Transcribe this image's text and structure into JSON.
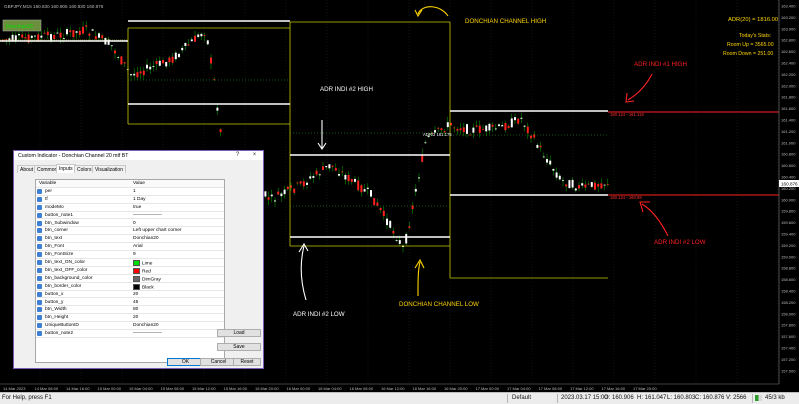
{
  "chart": {
    "symbol_header": "GBPJPY,M15 160.830 160.906 160.830 160.876",
    "indicator_badge": "Donchian20",
    "adr_label": "ADR(20) = 1816.00",
    "todays_stats": "Today's Stats:",
    "room_up": "Room Up = 3565.00",
    "room_down": "Room Down = 251.00",
    "red_line_label_top": "160.124 - 161.119",
    "red_line_label_bottom": "160.124 - 160.98",
    "inside_line_label": "ADR/2 161.176",
    "price_labels": [
      "163.400",
      "163.200",
      "163.000",
      "162.800",
      "162.600",
      "162.400",
      "162.200",
      "162.000",
      "161.800",
      "161.600",
      "161.400",
      "161.200",
      "161.000",
      "160.800",
      "160.600",
      "160.400",
      "160.200",
      "160.000",
      "159.800",
      "159.600",
      "159.400",
      "159.200",
      "159.000",
      "158.800",
      "158.600",
      "158.400",
      "158.200",
      "158.000",
      "157.800",
      "157.600",
      "157.400",
      "157.200",
      "157.000"
    ],
    "current_price": "160.876",
    "time_labels": [
      "14 Mar 2023",
      "14 Mar 08:00",
      "14 Mar 16:00",
      "15 Mar 00:00",
      "15 Mar 04:00",
      "15 Mar 08:00",
      "15 Mar 12:00",
      "15 Mar 16:00",
      "15 Mar 20:00",
      "16 Mar 00:00",
      "16 Mar 04:00",
      "16 Mar 08:00",
      "16 Mar 12:00",
      "16 Mar 16:00",
      "16 Mar 20:00",
      "17 Mar 00:00",
      "17 Mar 04:00",
      "17 Mar 08:00",
      "17 Mar 12:00",
      "17 Mar 16:00",
      "17 Mar 20:00"
    ],
    "colors": {
      "candle_up": "#ffffff",
      "candle_down": "#ff2020",
      "candle_wick": "#00c000",
      "donchian": "#c8c800",
      "adr_white": "#ffffff",
      "adr_red": "#ff2020",
      "grid": "#1a3a1a"
    }
  },
  "annotations": {
    "donchian_high": "DONCHIAN CHANNEL HIGH",
    "donchian_low": "DONCHIAN CHANNEL LOW",
    "adr2_high": "ADR INDI #2 HIGH",
    "adr2_low": "ADR INDI #2 LOW",
    "adr1_high": "ADR INDI #1 HIGH",
    "adr1_low": "ADR INDI #2 LOW"
  },
  "dialog": {
    "title": "Custom Indicator - Donchian Channel 20 mtf BT",
    "tabs": [
      "About",
      "Common",
      "Inputs",
      "Colors",
      "Visualization"
    ],
    "active_tab": "Inputs",
    "header_variable": "Variable",
    "header_value": "Value",
    "rows": [
      {
        "var": "per",
        "val": "1"
      },
      {
        "var": "tf",
        "val": "1 Day"
      },
      {
        "var": "modeMo",
        "val": "true"
      },
      {
        "var": "button_note1",
        "val": "——————"
      },
      {
        "var": "btn_Subwindow",
        "val": "0"
      },
      {
        "var": "btn_corner",
        "val": "Left upper chart corner"
      },
      {
        "var": "btn_text",
        "val": "Donchian20"
      },
      {
        "var": "btn_Font",
        "val": "Arial"
      },
      {
        "var": "btn_FontSize",
        "val": "9"
      },
      {
        "var": "btn_text_ON_color",
        "val": "Lime",
        "swatch": "#00e000"
      },
      {
        "var": "btn_text_OFF_color",
        "val": "Red",
        "swatch": "#ff0000"
      },
      {
        "var": "btn_background_color",
        "val": "DimGray",
        "swatch": "#696969"
      },
      {
        "var": "btn_border_color",
        "val": "Black",
        "swatch": "#000000"
      },
      {
        "var": "button_x",
        "val": "20"
      },
      {
        "var": "button_y",
        "val": "45"
      },
      {
        "var": "btn_Width",
        "val": "80"
      },
      {
        "var": "btn_Height",
        "val": "20"
      },
      {
        "var": "UniqueButtonID",
        "val": "Donchian20"
      },
      {
        "var": "button_note2",
        "val": "——————"
      }
    ],
    "load_label": "Load",
    "save_label": "Save",
    "ok_label": "OK",
    "cancel_label": "Cancel",
    "reset_label": "Reset"
  },
  "statusbar": {
    "help": "For Help, press F1",
    "profile": "Default",
    "datetime": "2023.03.17 15:00",
    "open": "O: 160.906",
    "high": "H: 161.047",
    "low": "L: 160.803",
    "close": "C: 160.876",
    "volume": "V: 2566",
    "traffic": "45/3 kb"
  }
}
